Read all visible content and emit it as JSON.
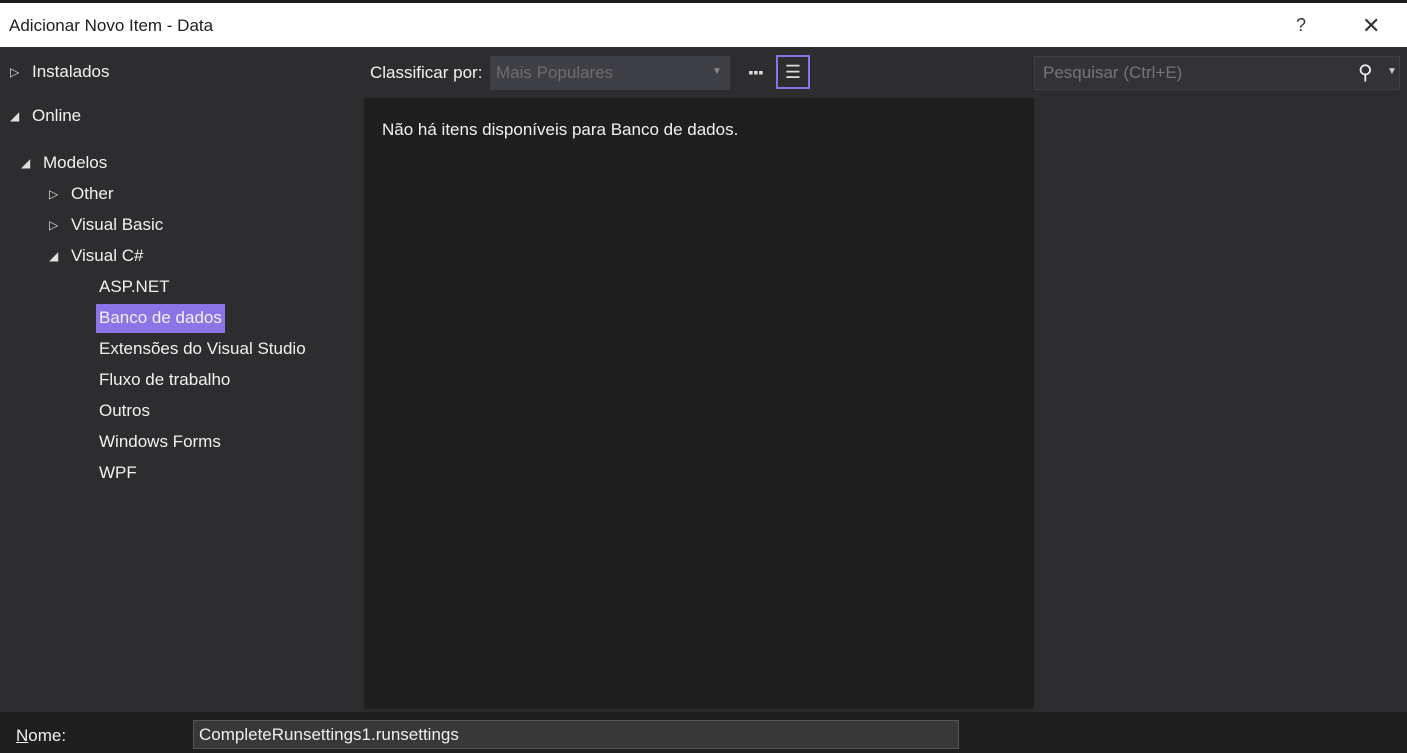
{
  "window": {
    "title": "Adicionar Novo Item - Data",
    "help": "?",
    "close": "✕"
  },
  "tree": {
    "installed": "Instalados",
    "online": "Online",
    "models": "Modelos",
    "other": "Other",
    "vb": "Visual Basic",
    "cs": "Visual C#",
    "children": [
      "ASP.NET",
      "Banco de dados",
      "Extensões do Visual Studio",
      "Fluxo de trabalho",
      "Outros",
      "Windows Forms",
      "WPF"
    ],
    "selected": "Banco de dados"
  },
  "toolbar": {
    "sort_label": "Classificar por:",
    "sort_value": "Mais Populares"
  },
  "content": {
    "empty_message": "Não há itens disponíveis para Banco de dados."
  },
  "search": {
    "placeholder": "Pesquisar (Ctrl+E)"
  },
  "footer": {
    "name_label_accel": "N",
    "name_label_rest": "ome:",
    "name_value": "CompleteRunsettings1.runsettings"
  },
  "colors": {
    "accent": "#8b74e6",
    "background": "#2d2d30",
    "panel": "#1f1f1f"
  }
}
